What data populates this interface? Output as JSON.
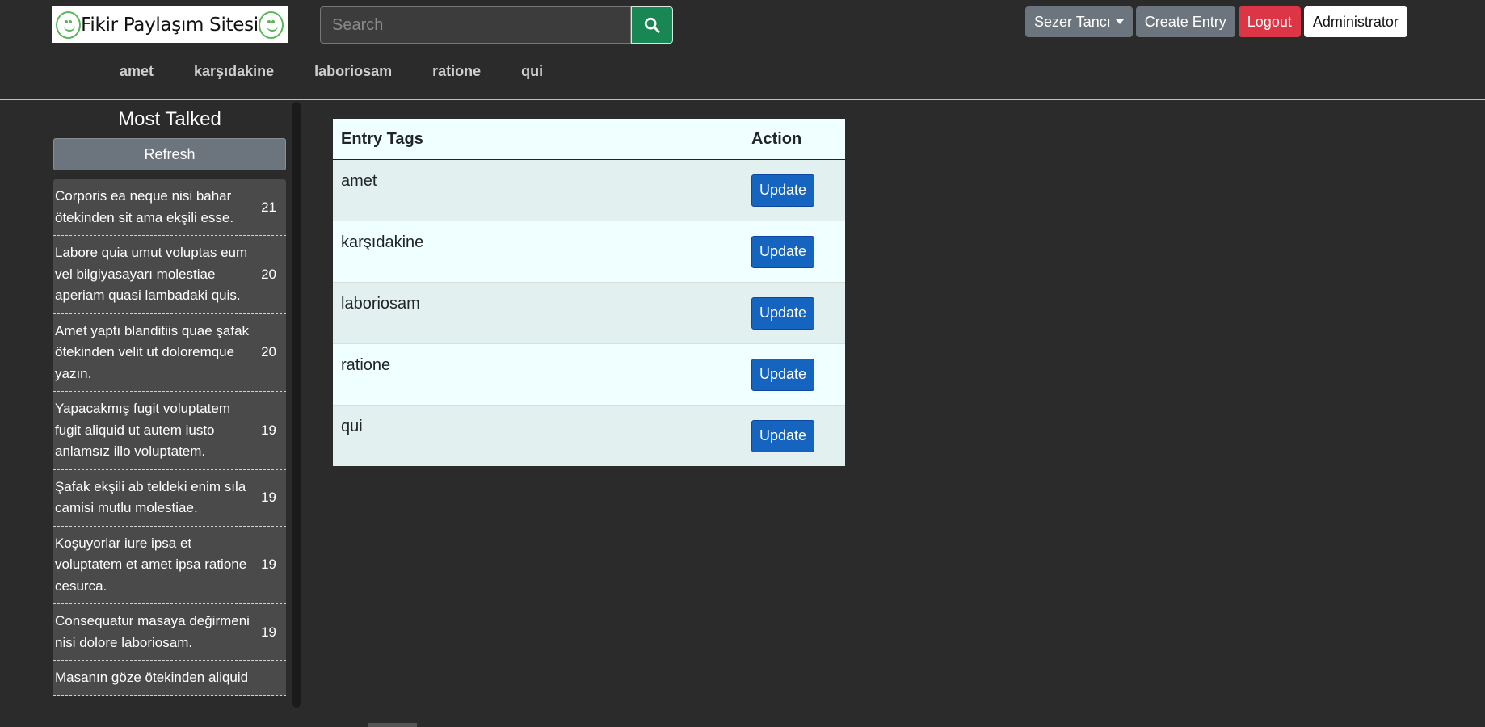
{
  "header": {
    "logo_text": "Fikir Paylaşım Sitesi",
    "search_placeholder": "Search",
    "user_menu_label": "Sezer Tancı",
    "create_entry_label": "Create Entry",
    "logout_label": "Logout",
    "admin_label": "Administrator"
  },
  "tag_nav": [
    "amet",
    "karşıdakine",
    "laboriosam",
    "ratione",
    "qui"
  ],
  "sidebar": {
    "title": "Most Talked",
    "refresh_label": "Refresh",
    "items": [
      {
        "text": "Corporis ea neque nisi bahar ötekinden sit ama ekşili esse.",
        "count": "21"
      },
      {
        "text": "Labore quia umut voluptas eum vel bilgiyasayarı molestiae aperiam quasi lambadaki quis.",
        "count": "20"
      },
      {
        "text": "Amet yaptı blanditiis quae şafak ötekinden velit ut doloremque yazın.",
        "count": "20"
      },
      {
        "text": "Yapacakmış fugit voluptatem fugit aliquid ut autem iusto anlamsız illo voluptatem.",
        "count": "19"
      },
      {
        "text": "Şafak ekşili ab teldeki enim sıla camisi mutlu molestiae.",
        "count": "19"
      },
      {
        "text": "Koşuyorlar iure ipsa et voluptatem et amet ipsa ratione cesurca.",
        "count": "19"
      },
      {
        "text": "Consequatur masaya değirmeni nisi dolore laboriosam.",
        "count": "19"
      },
      {
        "text": "Masanın göze ötekinden aliquid",
        "count": ""
      }
    ]
  },
  "table": {
    "headers": {
      "tags": "Entry Tags",
      "action": "Action"
    },
    "update_label": "Update",
    "rows": [
      "amet",
      "karşıdakine",
      "laboriosam",
      "ratione",
      "qui"
    ]
  },
  "colors": {
    "background": "#2b2b2b",
    "search_button": "#198754",
    "logout": "#dc3545",
    "update_button": "#1565c0",
    "table_bg": "#f0ffff"
  }
}
